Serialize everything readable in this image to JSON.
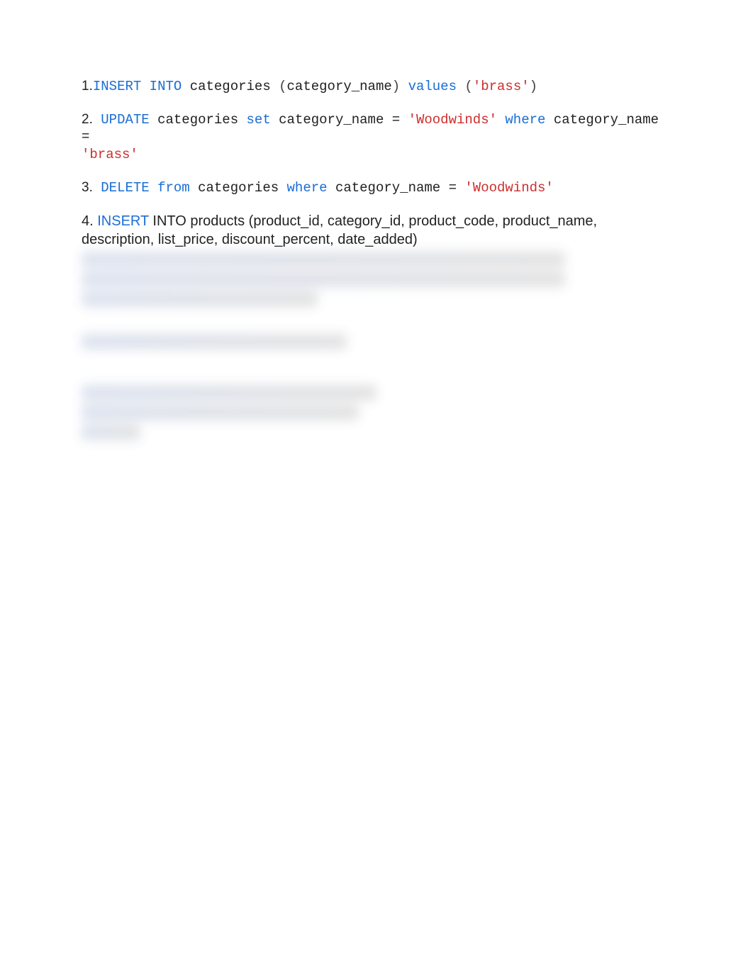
{
  "items": {
    "one": {
      "num": "1.",
      "t1": "INSERT",
      "t2": " INTO",
      "t3": " categories ",
      "t4": "(",
      "t5": "category_name",
      "t6": ")",
      "t7": " values",
      "t8": " (",
      "t9": "'brass'",
      "t10": ")"
    },
    "two": {
      "num": "2.",
      "t1": " UPDATE",
      "t2": " categories ",
      "t3": "set",
      "t4": " category_name = ",
      "t5": "'Woodwinds'",
      "t6": " where",
      "t7": " category_name = ",
      "t8": "'brass'"
    },
    "three": {
      "num": "3.",
      "t1": " DELETE",
      "t2": " from",
      "t3": " categories ",
      "t4": "where",
      "t5": " category_name = ",
      "t6": "'Woodwinds'"
    },
    "four": {
      "num": "4.",
      "t1": " INSERT",
      "t2": " INTO products (product_id, category_id, product_code, product_name, description, list_price, discount_percent, date_added)"
    }
  }
}
